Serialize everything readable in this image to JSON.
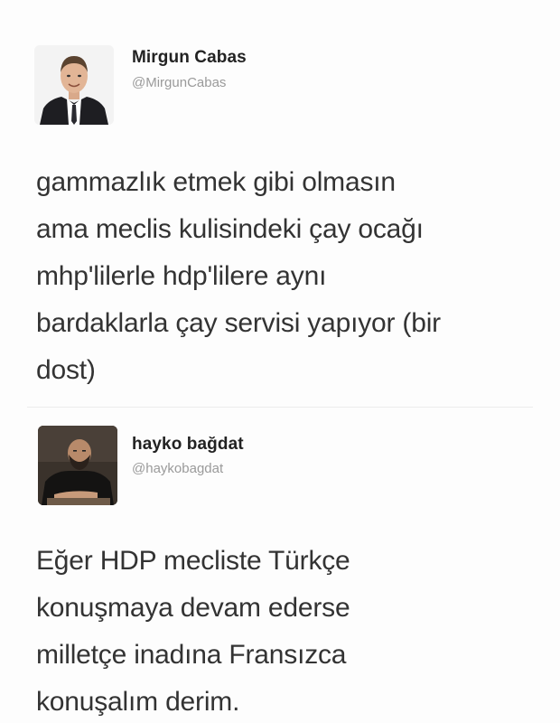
{
  "tweets": [
    {
      "display_name": "Mirgun Cabas",
      "handle": "@MirgunCabas",
      "avatar_icon": "man-in-suit-portrait",
      "text": "gammazlık etmek gibi olmasın\nama meclis kulisindeki çay ocağı\nmhp'lilerle hdp'lilere aynı\nbardaklarla çay servisi yapıyor (bir\ndost)"
    },
    {
      "display_name": "hayko bağdat",
      "handle": "@haykobagdat",
      "avatar_icon": "bearded-man-portrait",
      "text": "Eğer HDP mecliste Türkçe\nkonuşmaya devam ederse\nmilletçe inadına Fransızca\nkonuşalım derim."
    }
  ]
}
